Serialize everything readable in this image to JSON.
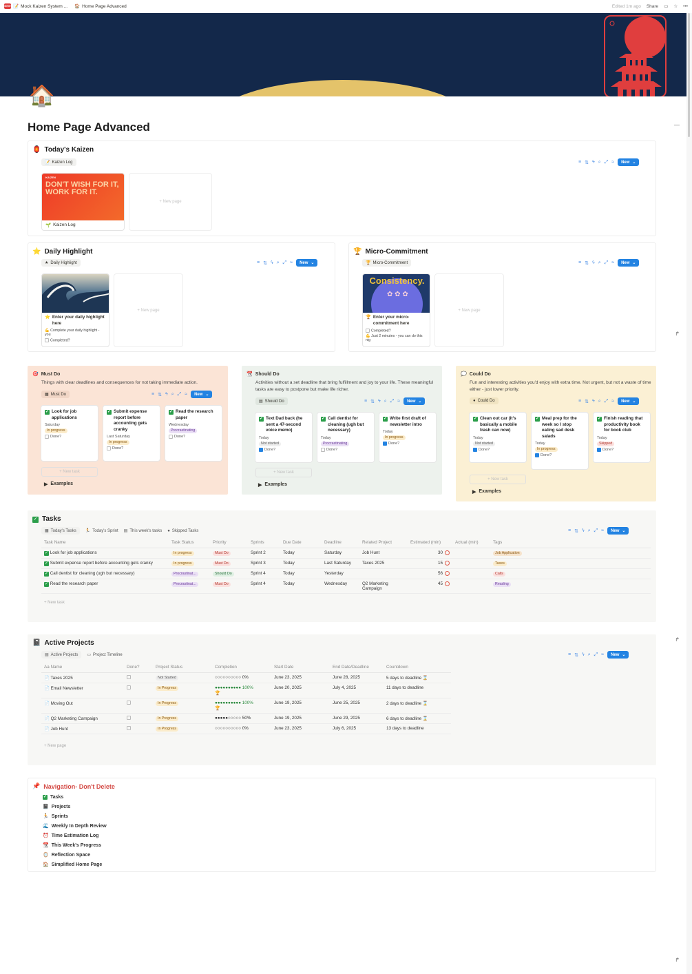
{
  "topbar": {
    "workspace": "Mock Kaizen System ...",
    "page": "Home Page Advanced",
    "edited": "Edited 1m ago",
    "share": "Share"
  },
  "page": {
    "title": "Home Page Advanced"
  },
  "kaizen": {
    "title": "Today's Kaizen",
    "tab": "Kaizen Log",
    "card_quote": "DON'T WISH FOR IT, WORK FOR IT.",
    "card_tag": "KAIZEN",
    "card_title": "Kaizen Log",
    "new_page": "+ New page",
    "new": "New"
  },
  "highlight": {
    "title": "Daily Highlight",
    "tab": "Daily Highlight",
    "card_title": "Enter your daily highlight here",
    "prop1": "Complete your daily highlight - you",
    "prop2": "Completed?",
    "new_page": "+ New page",
    "new": "New"
  },
  "micro": {
    "title": "Micro-Commitment",
    "tab": "Micro-Commitment",
    "cover_text": "Consistency.",
    "card_title": "Enter your micro-commitment here",
    "prop1": "Completed?",
    "prop2": "Just 2 minutes - you can do this nig",
    "new_page": "+ New page",
    "new": "New"
  },
  "must": {
    "title": "Must Do",
    "desc": "Things with clear deadlines and consequences for not taking immediate action.",
    "tab": "Must Do",
    "new": "New",
    "new_task": "+ New task",
    "examples": "Examples",
    "cards": [
      {
        "name": "Look for job applications",
        "date": "Saturday",
        "status": "In progress",
        "done": "Done?"
      },
      {
        "name": "Submit expense report before accounting gets cranky",
        "date": "Last Saturday",
        "status": "In progress",
        "done": "Done?"
      },
      {
        "name": "Read the research paper",
        "date": "Wednesday",
        "status": "Procrastinating",
        "done": "Done?"
      }
    ]
  },
  "should": {
    "title": "Should Do",
    "desc": "Activities without a set deadline that bring fulfillment and joy to your life. These meaningful tasks are easy to postpone but make life richer.",
    "tab": "Should Do",
    "new": "New",
    "new_task": "+ New task",
    "examples": "Examples",
    "cards": [
      {
        "name": "Text Dad back (he sent a 47-second voice memo)",
        "date": "Today",
        "status": "Not started",
        "done": "Done?"
      },
      {
        "name": "Call dentist for cleaning (ugh but necessary)",
        "date": "Today",
        "status": "Procrastinating",
        "done": "Done?"
      },
      {
        "name": "Write first draft of newsletter intro",
        "date": "Today",
        "status": "In progress",
        "done": "Done?"
      }
    ]
  },
  "could": {
    "title": "Could Do",
    "desc": "Fun and interesting activities you'd enjoy with extra time. Not urgent, but not a waste of time either - just lower priority.",
    "tab": "Could Do",
    "new": "New",
    "new_task": "+ New task",
    "examples": "Examples",
    "cards": [
      {
        "name": "Clean out car (it's basically a mobile trash can now)",
        "date": "Today",
        "status": "Not started",
        "done": "Done?"
      },
      {
        "name": "Meal prep for the week so I stop eating sad desk salads",
        "date": "Today",
        "status": "In progress",
        "done": "Done?"
      },
      {
        "name": "Finish reading that productivity book for book club",
        "date": "Today",
        "status": "Skipped",
        "done": "Done?"
      }
    ]
  },
  "tasks": {
    "title": "Tasks",
    "tabs": [
      "Today's Tasks",
      "Today's Sprint",
      "This week's tasks",
      "Skipped Tasks"
    ],
    "new": "New",
    "new_task": "+ New task",
    "headers": [
      "Task Name",
      "Task Status",
      "Priority",
      "Sprints",
      "Due Date",
      "Deadline",
      "Related Project",
      "Estimated (min)",
      "Actual (min)",
      "Tags"
    ],
    "rows": [
      {
        "name": "Look for job applications",
        "status": "In progress",
        "priority": "Must Do",
        "sprint": "Sprint 2",
        "due": "Today",
        "deadline": "Saturday",
        "project": "Job Hunt",
        "est": "30",
        "tag": "Job Application"
      },
      {
        "name": "Submit expense report before accounting gets cranky",
        "status": "In progress",
        "priority": "Must Do",
        "sprint": "Sprint 3",
        "due": "Today",
        "deadline": "Last Saturday",
        "project": "Taxes 2025",
        "est": "15",
        "tag": "Taxes"
      },
      {
        "name": "Call dentist for cleaning (ugh but necessary)",
        "status": "Procrastinat...",
        "priority": "Should Do",
        "sprint": "Sprint 4",
        "due": "Today",
        "deadline": "Yesterday",
        "project": "",
        "est": "56",
        "tag": "Calls"
      },
      {
        "name": "Read the research paper",
        "status": "Procrastinat...",
        "priority": "Must Do",
        "sprint": "Sprint 4",
        "due": "Today",
        "deadline": "Wednesday",
        "project": "Q2 Marketing Campaign",
        "est": "45",
        "tag": "Reading"
      }
    ]
  },
  "projects": {
    "title": "Active Projects",
    "tabs": [
      "Active Projects",
      "Project Timeline"
    ],
    "new": "New",
    "new_page": "+ New page",
    "headers": [
      "Aa Name",
      "Done?",
      "Project Status",
      "Completion",
      "Start Date",
      "End Date/Deadline",
      "Countdown"
    ],
    "rows": [
      {
        "name": "Taxes 2025",
        "status": "Not Started",
        "completion": "○○○○○○○○○○ 0%",
        "start": "June 23, 2025",
        "end": "June 28, 2025",
        "countdown": "5 days to deadline ⌛",
        "urgent": true
      },
      {
        "name": "Email Newsletter",
        "status": "In Progress",
        "completion": "●●●●●●●●●● 100%",
        "start": "June 20, 2025",
        "end": "July 4, 2025",
        "countdown": "11 days to deadline",
        "urgent": false
      },
      {
        "name": "Moving Out",
        "status": "In Progress",
        "completion": "●●●●●●●●●● 100%",
        "start": "June 19, 2025",
        "end": "June 25, 2025",
        "countdown": "2 days to deadline ⌛",
        "urgent": true
      },
      {
        "name": "Q2 Marketing Campaign",
        "status": "In Progress",
        "completion": "●●●●●○○○○○ 50%",
        "start": "June 19, 2025",
        "end": "June 29, 2025",
        "countdown": "6 days to deadline ⌛",
        "urgent": true
      },
      {
        "name": "Job Hunt",
        "status": "In Progress",
        "completion": "○○○○○○○○○○ 0%",
        "start": "June 23, 2025",
        "end": "July 6, 2025",
        "countdown": "13 days to deadline",
        "urgent": false
      }
    ]
  },
  "navigation": {
    "title": "Navigation- Don't Delete",
    "items": [
      "Tasks",
      "Projects",
      "Sprints",
      "Weekly In Depth Review",
      "Time Estimation Log",
      "This Week's Progress",
      "Reflection Space",
      "Simplified Home Page"
    ]
  },
  "colors": {
    "cover": "#13284a",
    "sun": "#e4c36a",
    "accent": "#2383e2",
    "must_bg": "#fbe4d6",
    "should_bg": "#edf2ed",
    "could_bg": "#fbf0d4"
  }
}
